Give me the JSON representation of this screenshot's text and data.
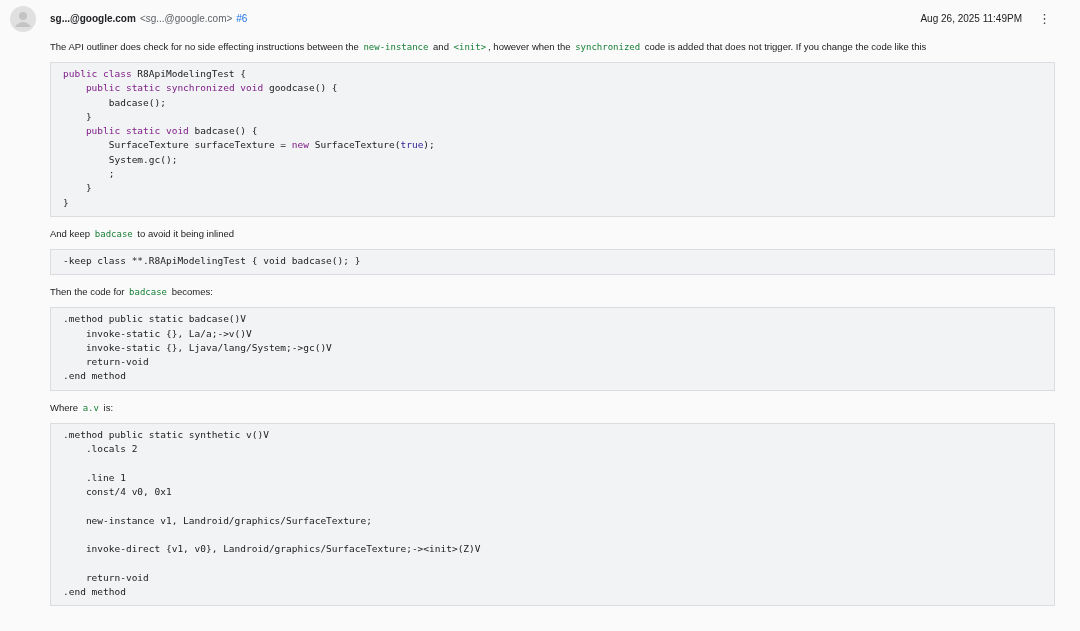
{
  "comment": {
    "author": "sg...@google.com",
    "email": "<sg...@google.com>",
    "number": "#6",
    "date": "Aug 26, 2025 11:49PM",
    "menu": "⋮"
  },
  "body": [
    {
      "kind": "paragraph",
      "parts": [
        {
          "kind": "text",
          "text": "The API outliner does check for no side effecting instructions between the "
        },
        {
          "kind": "code",
          "text": "new-instance"
        },
        {
          "kind": "text",
          "text": " and "
        },
        {
          "kind": "code",
          "text": "<init>"
        },
        {
          "kind": "text",
          "text": ", however when the "
        },
        {
          "kind": "code",
          "text": "synchronized"
        },
        {
          "kind": "text",
          "text": " code is added that does not trigger. If you change the code like this"
        }
      ]
    },
    {
      "kind": "code",
      "tokens": [
        {
          "kind": "keyword",
          "text": "public class"
        },
        {
          "kind": "plain",
          "text": " R8ApiModelingTest {\n    "
        },
        {
          "kind": "keyword",
          "text": "public static synchronized void"
        },
        {
          "kind": "plain",
          "text": " goodcase() {\n        badcase();\n    }\n    "
        },
        {
          "kind": "keyword",
          "text": "public static void"
        },
        {
          "kind": "plain",
          "text": " badcase() {\n        SurfaceTexture surfaceTexture = "
        },
        {
          "kind": "keyword",
          "text": "new"
        },
        {
          "kind": "plain",
          "text": " SurfaceTexture("
        },
        {
          "kind": "literal",
          "text": "true"
        },
        {
          "kind": "plain",
          "text": ");\n        System.gc();\n        ;\n    }\n}"
        }
      ]
    },
    {
      "kind": "paragraph",
      "parts": [
        {
          "kind": "text",
          "text": "And keep "
        },
        {
          "kind": "code",
          "text": "badcase"
        },
        {
          "kind": "text",
          "text": " to avoid it being inlined"
        }
      ]
    },
    {
      "kind": "code",
      "tokens": [
        {
          "kind": "plain",
          "text": "-keep class **.R8ApiModelingTest { void badcase(); }"
        }
      ]
    },
    {
      "kind": "paragraph",
      "parts": [
        {
          "kind": "text",
          "text": "Then the code for "
        },
        {
          "kind": "code",
          "text": "badcase"
        },
        {
          "kind": "text",
          "text": " becomes:"
        }
      ]
    },
    {
      "kind": "code",
      "tokens": [
        {
          "kind": "plain",
          "text": ".method public static badcase()V\n    invoke-static {}, La/a;->v()V\n    invoke-static {}, Ljava/lang/System;->gc()V\n    return-void\n.end method"
        }
      ]
    },
    {
      "kind": "paragraph",
      "parts": [
        {
          "kind": "text",
          "text": "Where "
        },
        {
          "kind": "code",
          "text": "a.v"
        },
        {
          "kind": "text",
          "text": " is:"
        }
      ]
    },
    {
      "kind": "code",
      "tokens": [
        {
          "kind": "plain",
          "text": ".method public static synthetic v()V\n    .locals 2\n\n    .line 1\n    const/4 v0, 0x1\n\n    new-instance v1, Landroid/graphics/SurfaceTexture;\n\n    invoke-direct {v1, v0}, Landroid/graphics/SurfaceTexture;-><init>(Z)V\n\n    return-void\n.end method"
        }
      ]
    }
  ]
}
